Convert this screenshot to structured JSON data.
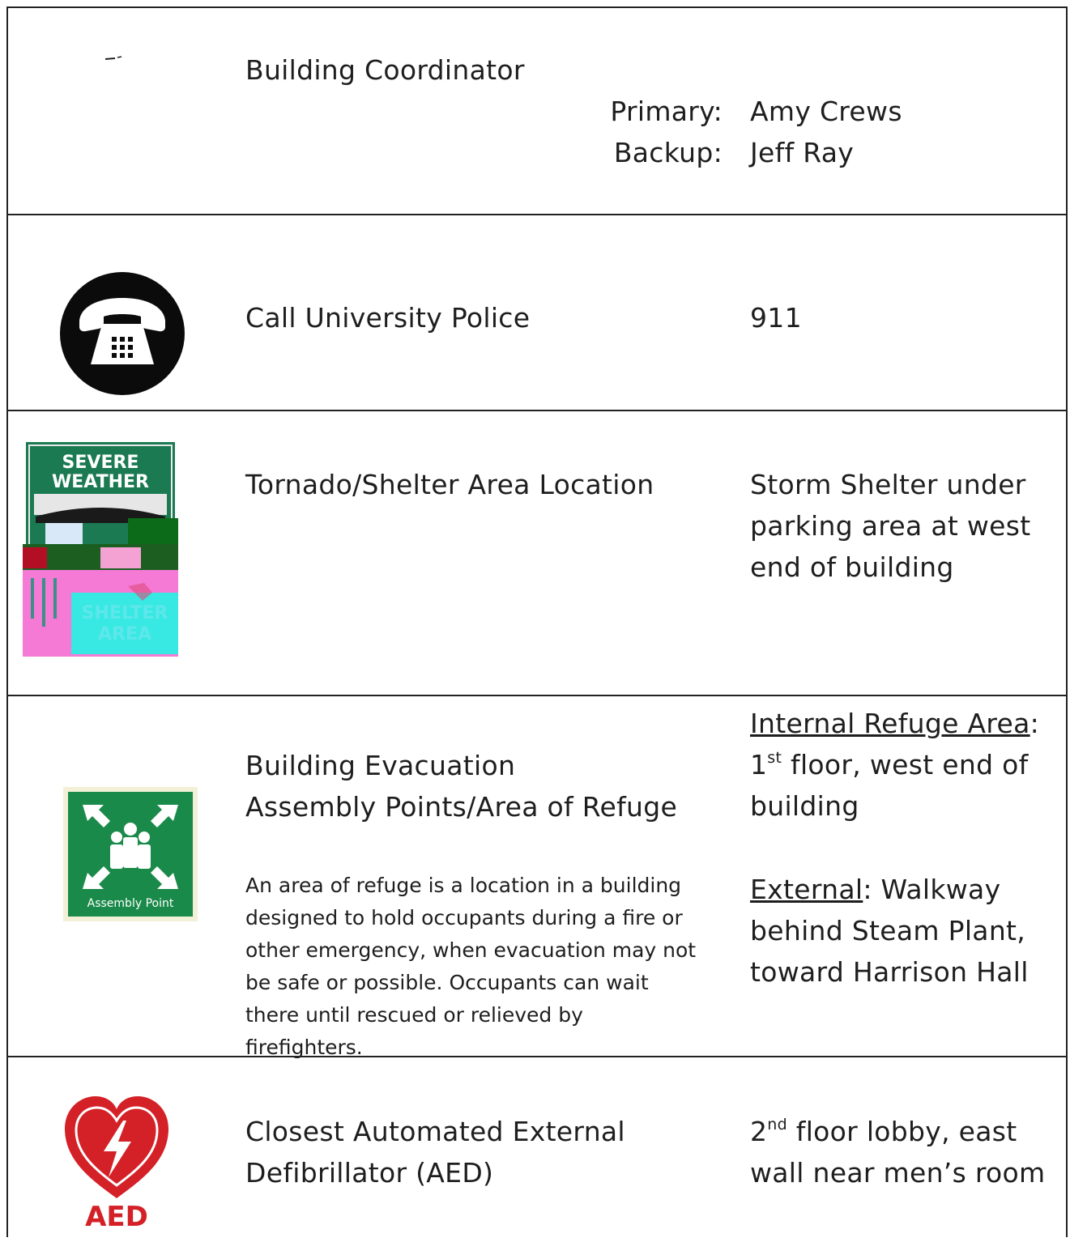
{
  "coordinator": {
    "title": "Building Coordinator",
    "primary_label": "Primary:",
    "primary_name": "Amy Crews",
    "backup_label": "Backup:",
    "backup_name": "Jeff Ray"
  },
  "police": {
    "title": "Call University Police",
    "number": "911",
    "icon": "telephone-icon"
  },
  "tornado": {
    "title": "Tornado/Shelter Area Location",
    "location_lines": [
      "Storm Shelter under",
      "parking area at west",
      "end of building"
    ],
    "sign_text_top": [
      "SEVERE",
      "WEATHER"
    ],
    "sign_text_bottom": [
      "SHELTER",
      "AREA"
    ]
  },
  "evacuation": {
    "title_lines": [
      "Building Evacuation",
      "Assembly Points/Area of Refuge"
    ],
    "description_lines": [
      "An area of refuge is a location in a building",
      "designed to hold occupants during a fire or",
      "other emergency, when evacuation may not",
      "be safe or possible. Occupants can wait",
      "there until rescued or relieved by",
      "firefighters."
    ],
    "internal_label": "Internal Refuge Area",
    "internal_colon": ":",
    "internal_line1_num": "1",
    "internal_line1_sup": "st",
    "internal_line1_rest": " floor, west end of",
    "internal_line2": "building",
    "external_label": "External",
    "external_line1_rest": ": Walkway",
    "external_line2": "behind Steam Plant,",
    "external_line3": "toward Harrison Hall",
    "sign_caption": "Assembly Point"
  },
  "aed": {
    "title_lines": [
      "Closest Automated External",
      "Defibrillator (AED)"
    ],
    "location_line1_num": "2",
    "location_line1_sup": "nd",
    "location_line1_rest": " floor lobby, east",
    "location_line2": "wall near men’s room",
    "logo_text": "AED"
  },
  "colors": {
    "border": "#222222",
    "text": "#1e1e1e",
    "sign_green": "#1a8a4a",
    "aed_red": "#d42027"
  }
}
